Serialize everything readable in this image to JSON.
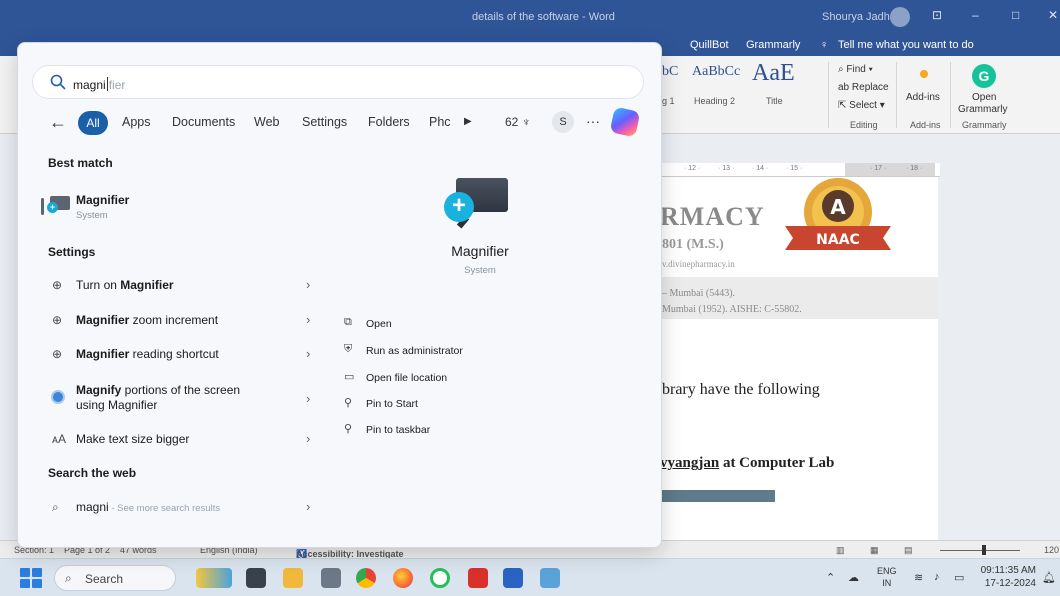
{
  "word": {
    "title": "details of the software - Word",
    "user": "Shourya Jadhav",
    "window_controls": [
      "⊡",
      "–",
      "□",
      "✕"
    ],
    "tabs": [
      "QuillBot",
      "Grammarly"
    ],
    "tell_me": "Tell me what you want to do",
    "styles": [
      {
        "preview": "bC",
        "caption": "g 1"
      },
      {
        "preview": "AaBbCc",
        "caption": "Heading 2"
      },
      {
        "preview": "AaE",
        "caption": "Title"
      }
    ],
    "editing": {
      "find": "Find",
      "replace": "Replace",
      "select": "Select",
      "group": "Editing"
    },
    "addins": {
      "label": "Add-ins",
      "group": "Add-ins"
    },
    "grammarly": {
      "label1": "Open",
      "label2": "Grammarly",
      "group": "Grammarly",
      "badge": "G"
    },
    "ruler_ticks": [
      "· 12 ·",
      "· 13 ·",
      "· 14 ·",
      "· 15 ·",
      "· 17 ·",
      "· 18 ·"
    ],
    "doc": {
      "heading": "RMACY",
      "sub": "801 (M.S.)",
      "url": "v.divinepharmacy.in",
      "line1": "– Mumbai (5443).",
      "line2": "Mumbai (1952). AISHE: C-55802.",
      "para": "brary have the following",
      "bold_line_prefix": "vyangjan",
      "bold_line_suffix": " at Computer Lab"
    },
    "naac": {
      "letter": "A",
      "label": "NAAC"
    },
    "status": {
      "section": "Section: 1",
      "page": "Page 1 of 2",
      "words": "47 words",
      "language": "English (India)",
      "accessibility": "Accessibility: Investigate",
      "zoom": "120"
    }
  },
  "search": {
    "typed": "magni",
    "suggestion_rest": "fier",
    "filters": {
      "active": "All",
      "items": [
        "Apps",
        "Documents",
        "Web",
        "Settings",
        "Folders",
        "Phc"
      ],
      "count": "62",
      "avatar": "S",
      "more": "···"
    },
    "best_match_label": "Best match",
    "best_match": {
      "name": "Magnifier",
      "sub": "System"
    },
    "settings_label": "Settings",
    "settings": [
      {
        "pre": "Turn on ",
        "bold": "Magnifier",
        "post": ""
      },
      {
        "pre": "",
        "bold": "Magnifier",
        "post": " zoom increment"
      },
      {
        "pre": "",
        "bold": "Magnifier",
        "post": " reading shortcut"
      },
      {
        "pre": "",
        "bold": "Magnify",
        "post": " portions of the screen using Magnifier"
      },
      {
        "pre": "Make text size bigger",
        "bold": "",
        "post": ""
      }
    ],
    "web_label": "Search the web",
    "web": {
      "term": "magni",
      "suffix": " - See more search results"
    },
    "preview": {
      "name": "Magnifier",
      "sub": "System"
    },
    "actions": [
      "Open",
      "Run as administrator",
      "Open file location",
      "Pin to Start",
      "Pin to taskbar"
    ]
  },
  "taskbar": {
    "search": "Search",
    "lang_top": "ENG",
    "lang_bottom": "IN",
    "time": "09:11:35 AM",
    "date": "17-12-2024"
  },
  "colors": {
    "accent": "#1b5fa8",
    "word_blue": "#2f5597",
    "magnifier_blue": "#19b2df"
  }
}
